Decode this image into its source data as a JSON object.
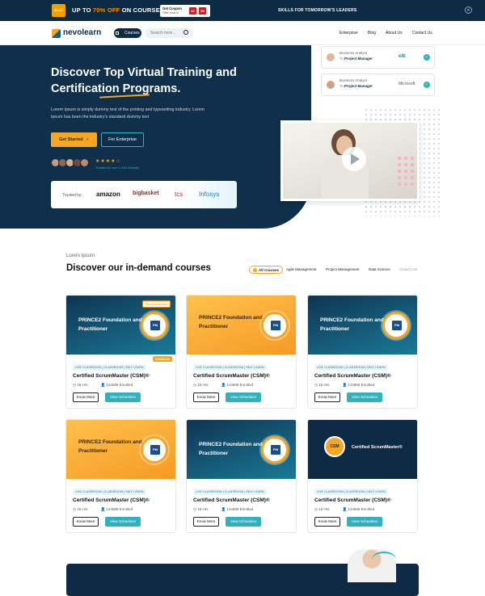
{
  "topbar": {
    "sale_badge": "SALE",
    "promo_prefix": "UP TO ",
    "promo_highlight": "70% OFF",
    "promo_suffix": " ON COURSES",
    "coupon_title": "Get Coupon",
    "coupon_sub": "Offer ends in",
    "timer": [
      "02",
      "55"
    ],
    "tagline": "SKILLS FOR TOMORROW'S LEADERS"
  },
  "nav": {
    "logo": "nevolearn",
    "courses_button": "Courses",
    "search_placeholder": "Search here...",
    "links": [
      "Enterprise",
      "Blog",
      "About Us",
      "Contact Us"
    ]
  },
  "hero": {
    "title": "Discover Top Virtual Training and Certification Programs.",
    "description": "Lorem Ipsum is simply dummy text of the printing and typesetting industry. Lorem Ipsum has been the industry's standard dummy text",
    "primary_button": "Get Started",
    "secondary_button": "For Enterprise",
    "rating_stars": "★★★★☆",
    "trusted_by_count": "Trusted by over 1,000 Globally",
    "trusted_label": "Trusted by:",
    "brands": [
      "amazon",
      "bigbasket",
      "tcs",
      "Infosys"
    ]
  },
  "side_cards": [
    {
      "role": "Business Analyst",
      "to": "To ",
      "target": "Project Manager",
      "company": "citi"
    },
    {
      "role": "Business Analyst",
      "to": "To ",
      "target": "Project Manager",
      "company": "Microsoft"
    }
  ],
  "courses_section": {
    "eyebrow": "Lorem Ipsum",
    "title": "Discover our in-demand courses",
    "filters": [
      "All Courses",
      "Agile Management",
      "Project Management",
      "Data Science",
      "Cloud Com"
    ]
  },
  "cards": [
    {
      "banner": "PRINCE2 Foundation and Practitioner",
      "tag": "LIVE CLASSROOM | CLASSROOM | SELF LEARN",
      "title": "Certified ScrumMaster (CSM)®",
      "hours": "16 Hrs",
      "enrolled": "144689 Enrolled",
      "know_more": "Know More",
      "view_schedules": "View Schedules",
      "recommended": "Recommended",
      "certified": "Certificate"
    },
    {
      "banner": "PRINCE2 Foundation and Practitioner",
      "tag": "LIVE CLASSROOM | CLASSROOM | SELF LEARN",
      "title": "Certified ScrumMaster (CSM)®",
      "hours": "16 Hrs",
      "enrolled": "144689 Enrolled",
      "know_more": "Know More",
      "view_schedules": "View Schedules"
    },
    {
      "banner": "PRINCE2 Foundation and Practitioner",
      "tag": "LIVE CLASSROOM | CLASSROOM | SELF LEARN",
      "title": "Certified ScrumMaster (CSM)®",
      "hours": "16 Hrs",
      "enrolled": "144689 Enrolled",
      "know_more": "Know More",
      "view_schedules": "View Schedules"
    },
    {
      "banner": "PRINCE2 Foundation and Practitioner",
      "tag": "LIVE CLASSROOM | CLASSROOM | SELF LEARN",
      "title": "Certified ScrumMaster (CSM)®",
      "hours": "16 Hrs",
      "enrolled": "144689 Enrolled",
      "know_more": "Know More",
      "view_schedules": "View Schedules"
    },
    {
      "banner": "PRINCE2 Foundation and Practitioner",
      "tag": "LIVE CLASSROOM | CLASSROOM | SELF LEARN",
      "title": "Certified ScrumMaster (CSM)®",
      "hours": "16 Hrs",
      "enrolled": "144689 Enrolled",
      "know_more": "Know More",
      "view_schedules": "View Schedules"
    },
    {
      "banner": "Certified ScrumMaster®",
      "seal": "CSM",
      "tag": "LIVE CLASSROOM | CLASSROOM | SELF LEARN",
      "title": "Certified ScrumMaster (CSM)®",
      "hours": "16 Hrs",
      "enrolled": "144689 Enrolled",
      "know_more": "Know More",
      "view_schedules": "View Schedules"
    }
  ],
  "colors": {
    "navy": "#0f2f4a",
    "accent": "#f5a623",
    "teal": "#2fb1c0"
  }
}
